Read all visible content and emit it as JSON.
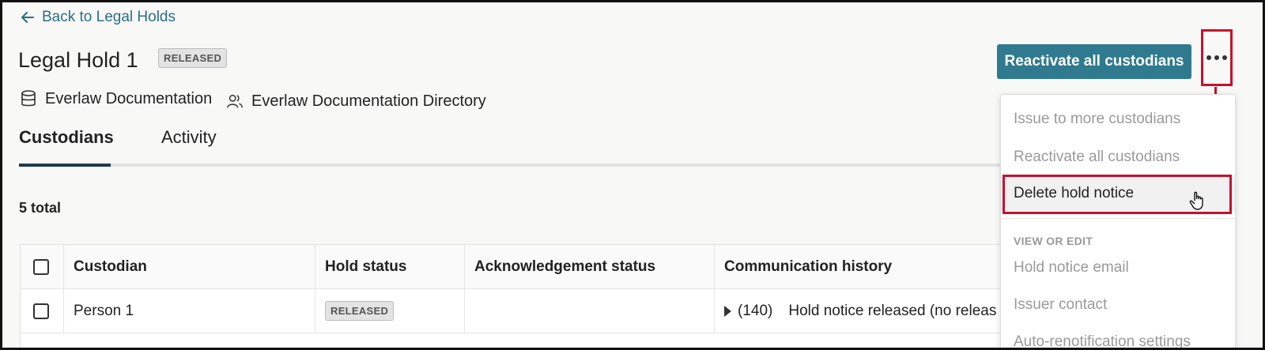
{
  "back_link": {
    "label": "Back to Legal Holds",
    "icon": "arrow-left-icon"
  },
  "header": {
    "title": "Legal Hold 1",
    "status_badge": "RELEASED",
    "database": {
      "label": "Everlaw Documentation",
      "icon": "database-icon"
    },
    "directory": {
      "label": "Everlaw Documentation Directory",
      "icon": "users-icon"
    },
    "primary_action": "Reactivate all custodians",
    "more_icon": "ellipsis-icon"
  },
  "tabs": [
    {
      "label": "Custodians",
      "active": true
    },
    {
      "label": "Activity",
      "active": false
    }
  ],
  "summary": {
    "total": "5 total"
  },
  "table": {
    "columns": [
      "Custodian",
      "Hold status",
      "Acknowledgement status",
      "Communication history"
    ],
    "rows": [
      {
        "custodian": "Person 1",
        "hold_status": "RELEASED",
        "acknowledgement_status": "",
        "communication_count": "(140)",
        "communication_text": "Hold notice released (no releas"
      }
    ]
  },
  "menu": {
    "items": [
      {
        "label": "Issue to more custodians",
        "disabled": true
      },
      {
        "label": "Reactivate all custodians",
        "disabled": true
      },
      {
        "label": "Delete hold notice",
        "disabled": false,
        "highlighted": true
      }
    ],
    "section_title": "VIEW OR EDIT",
    "section_items": [
      {
        "label": "Hold notice email"
      },
      {
        "label": "Issuer contact"
      },
      {
        "label": "Auto-renotification settings"
      }
    ]
  },
  "colors": {
    "accent": "#2f7a8f",
    "link": "#2b6f86",
    "annotation": "#c8102e"
  }
}
